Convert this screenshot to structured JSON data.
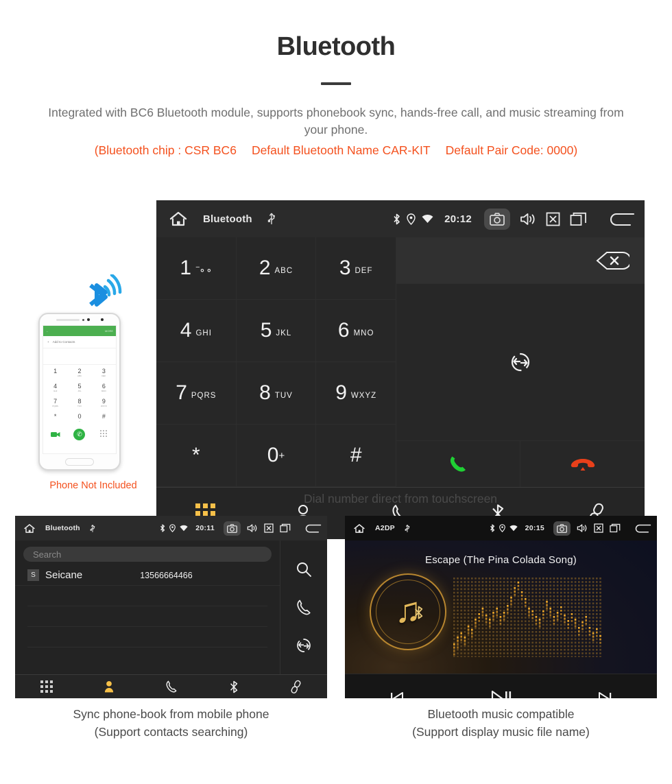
{
  "header": {
    "title": "Bluetooth",
    "subtitle": "Integrated with BC6 Bluetooth module, supports phonebook sync, hands-free call, and music streaming from your phone.",
    "spec_items": [
      "(Bluetooth chip : CSR BC6",
      "Default Bluetooth Name CAR-KIT",
      "Default Pair Code: 0000)"
    ]
  },
  "phone_mock": {
    "note": "Phone Not Included",
    "app_bar_action": "MORE",
    "add_to_contacts": "Add to Contacts",
    "keys": [
      {
        "num": "1",
        "sub": ""
      },
      {
        "num": "2",
        "sub": "ABC"
      },
      {
        "num": "3",
        "sub": "DEF"
      },
      {
        "num": "4",
        "sub": "GHI"
      },
      {
        "num": "5",
        "sub": "JKL"
      },
      {
        "num": "6",
        "sub": "MNO"
      },
      {
        "num": "7",
        "sub": "PQRS"
      },
      {
        "num": "8",
        "sub": "TUV"
      },
      {
        "num": "9",
        "sub": "WXYZ"
      },
      {
        "num": "*",
        "sub": ""
      },
      {
        "num": "0",
        "sub": "+"
      },
      {
        "num": "#",
        "sub": ""
      }
    ]
  },
  "dialer": {
    "statusbar": {
      "title": "Bluetooth",
      "clock": "20:12",
      "icons": [
        "home-icon",
        "usb-icon",
        "bluetooth-icon",
        "location-icon",
        "wifi-icon",
        "camera-icon",
        "volume-icon",
        "close-icon",
        "recents-icon",
        "back-icon"
      ]
    },
    "keys": [
      {
        "num": "1",
        "sub": "",
        "voicemail": true
      },
      {
        "num": "2",
        "sub": "ABC"
      },
      {
        "num": "3",
        "sub": "DEF"
      },
      {
        "num": "4",
        "sub": "GHI"
      },
      {
        "num": "5",
        "sub": "JKL"
      },
      {
        "num": "6",
        "sub": "MNO"
      },
      {
        "num": "7",
        "sub": "PQRS"
      },
      {
        "num": "8",
        "sub": "TUV"
      },
      {
        "num": "9",
        "sub": "WXYZ"
      },
      {
        "num": "*",
        "sub": ""
      },
      {
        "num": "0",
        "sub": "+"
      },
      {
        "num": "#",
        "sub": ""
      }
    ],
    "actions": {
      "backspace": "backspace-icon",
      "transfer": "transfer-call-icon",
      "call": "call-icon",
      "hangup": "hangup-icon"
    },
    "toolbar": [
      {
        "name": "keypad",
        "icon": "keypad-icon",
        "active": true
      },
      {
        "name": "contacts",
        "icon": "contacts-icon",
        "active": false
      },
      {
        "name": "call-log",
        "icon": "phone-icon",
        "active": false
      },
      {
        "name": "bluetooth",
        "icon": "bluetooth-icon",
        "active": false
      },
      {
        "name": "pair",
        "icon": "link-icon",
        "active": false
      }
    ],
    "caption": "Dial number direct from touchscreen"
  },
  "phonebook": {
    "statusbar": {
      "title": "Bluetooth",
      "clock": "20:11"
    },
    "search_placeholder": "Search",
    "contacts": [
      {
        "initial": "S",
        "name": "Seicane",
        "number": "13566664466"
      }
    ],
    "side_actions": [
      "search-icon",
      "phone-icon",
      "sync-icon"
    ],
    "toolbar": [
      {
        "name": "keypad",
        "icon": "keypad-icon",
        "active": false
      },
      {
        "name": "contacts",
        "icon": "contacts-icon",
        "active": true
      },
      {
        "name": "call-log",
        "icon": "phone-icon",
        "active": false
      },
      {
        "name": "bluetooth",
        "icon": "bluetooth-icon",
        "active": false
      },
      {
        "name": "pair",
        "icon": "link-icon",
        "active": false
      }
    ],
    "caption_line1": "Sync phone-book from mobile phone",
    "caption_line2": "(Support contacts searching)"
  },
  "music": {
    "statusbar": {
      "title": "A2DP",
      "clock": "20:15"
    },
    "track_title": "Escape (The Pina Colada Song)",
    "controls": [
      "previous-icon",
      "play-pause-icon",
      "next-icon"
    ],
    "caption_line1": "Bluetooth music compatible",
    "caption_line2": "(Support display music file name)"
  },
  "colors": {
    "accent_orange": "#f4511e",
    "accent_amber": "#f6c049",
    "call_green": "#1fd034",
    "hangup_red": "#e8401a",
    "gold": "#e3b85a"
  }
}
